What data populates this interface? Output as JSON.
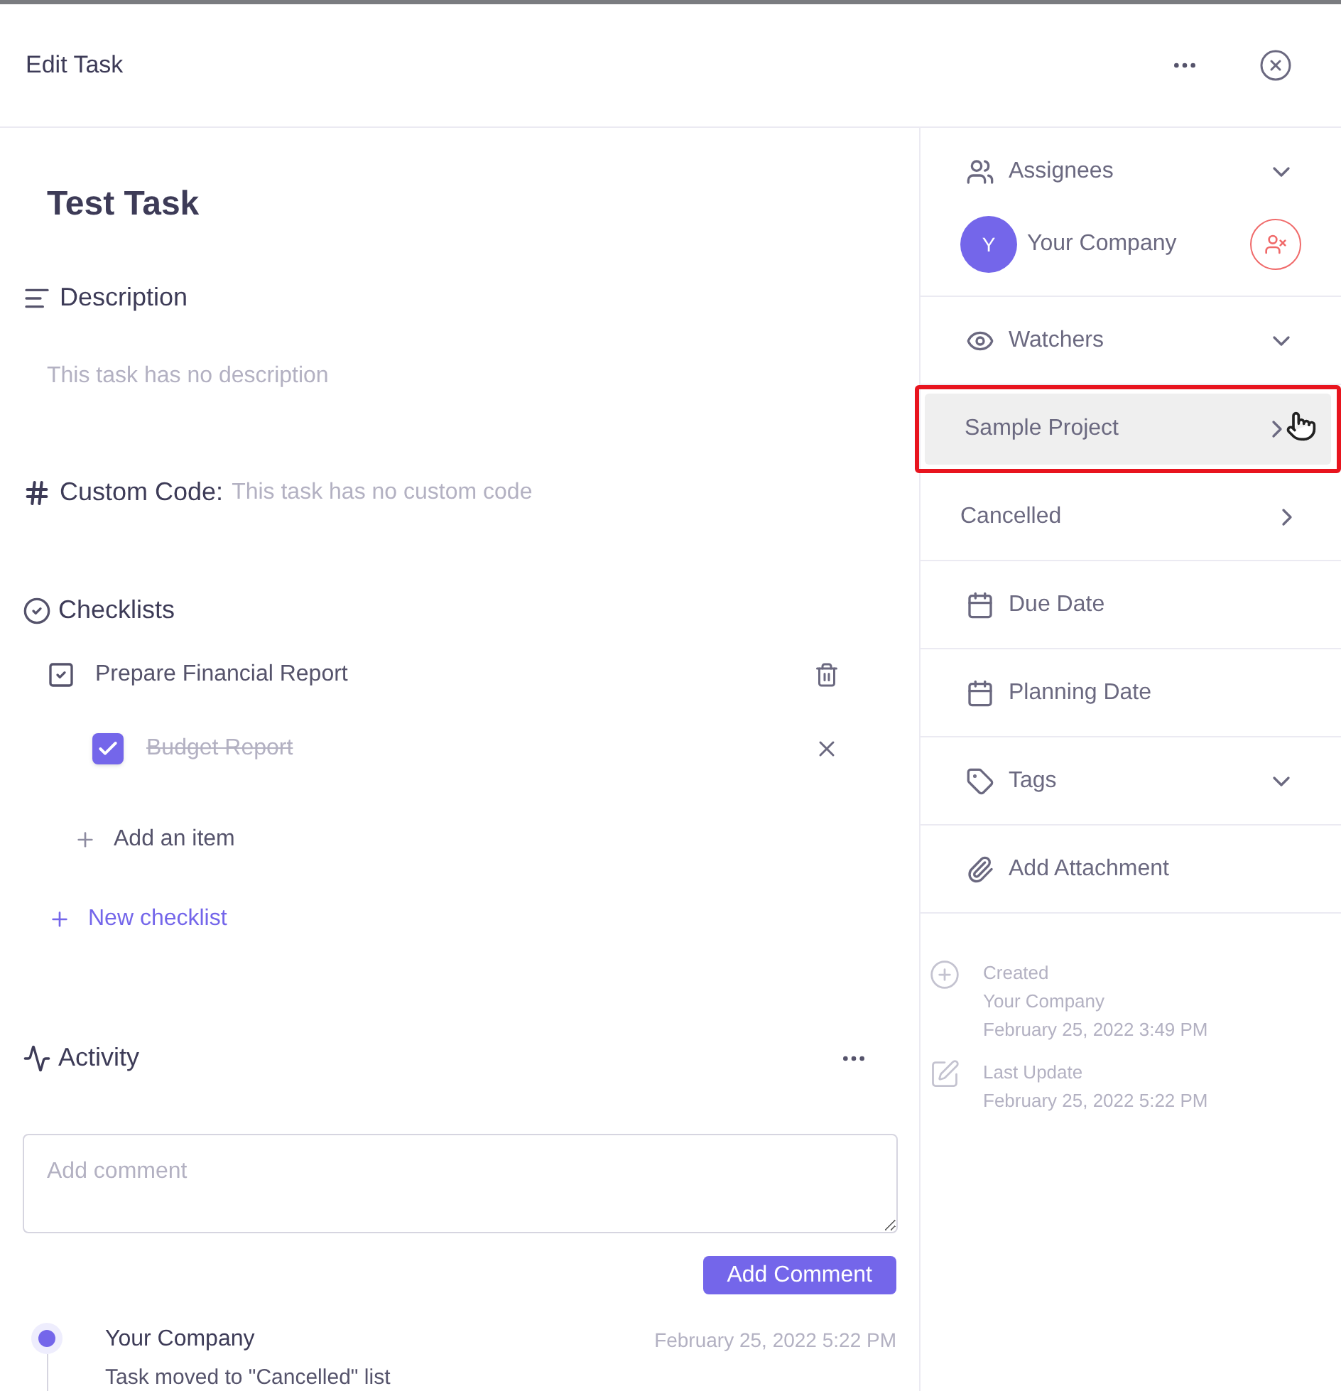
{
  "window": {
    "title": "Edit Task"
  },
  "task": {
    "title": "Test Task"
  },
  "description": {
    "heading": "Description",
    "text": "This task has no description"
  },
  "custom_code": {
    "label": "Custom Code:",
    "text": "This task has no custom code"
  },
  "checklists": {
    "heading": "Checklists",
    "lists": [
      {
        "title": "Prepare Financial Report",
        "items": [
          {
            "label": "Budget Report",
            "checked": true
          }
        ],
        "add_item": "Add an item"
      }
    ],
    "new_checklist": "New checklist"
  },
  "activity": {
    "heading": "Activity",
    "comment": {
      "placeholder": "Add comment"
    },
    "button": "Add Comment",
    "entries": [
      {
        "author": "Your Company",
        "time": "February 25, 2022 5:22 PM",
        "text": "Task moved to \"Cancelled\" list"
      }
    ]
  },
  "sidebar": {
    "assignees": {
      "label": "Assignees",
      "people": [
        {
          "initial": "Y",
          "name": "Your Company"
        }
      ]
    },
    "watchers": {
      "label": "Watchers"
    },
    "links": [
      {
        "label": "Sample Project",
        "selected": true
      },
      {
        "label": "Cancelled",
        "selected": false
      }
    ],
    "due_date": "Due Date",
    "planning_date": "Planning Date",
    "tags": "Tags",
    "attachment": "Add Attachment",
    "created": {
      "label": "Created",
      "by": "Your Company",
      "time": "February 25, 2022 3:49 PM"
    },
    "updated": {
      "label": "Last Update",
      "time": "February 25, 2022 5:22 PM"
    }
  }
}
